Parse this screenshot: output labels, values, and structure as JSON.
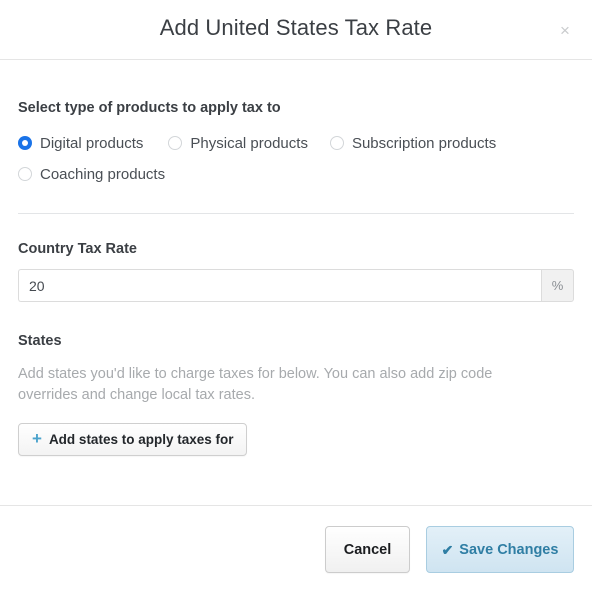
{
  "modal": {
    "title": "Add United States Tax Rate",
    "close_icon": "close-icon",
    "close_glyph": "×"
  },
  "products": {
    "label": "Select type of products to apply tax to",
    "options": [
      {
        "label": "Digital products",
        "selected": true
      },
      {
        "label": "Physical products",
        "selected": false
      },
      {
        "label": "Subscription products",
        "selected": false
      },
      {
        "label": "Coaching products",
        "selected": false
      }
    ]
  },
  "country_tax": {
    "label": "Country Tax Rate",
    "value": "20",
    "placeholder": "",
    "unit": "%"
  },
  "states": {
    "label": "States",
    "description": "Add states you'd like to charge taxes for below. You can also add zip code overrides and change local tax rates.",
    "add_button_label": "Add states to apply taxes for",
    "add_button_icon": "plus-icon",
    "add_button_glyph": "+"
  },
  "footer": {
    "cancel_label": "Cancel",
    "save_label": "Save Changes",
    "save_icon": "check-icon",
    "save_glyph": "✔"
  },
  "colors": {
    "radio_selected": "#1a73e8",
    "plus_icon": "#4ba3cc",
    "save_text": "#2f7ea4",
    "save_bg": "#d9ebf5",
    "save_border": "#a9cde1",
    "help_text": "#a7aaad"
  }
}
